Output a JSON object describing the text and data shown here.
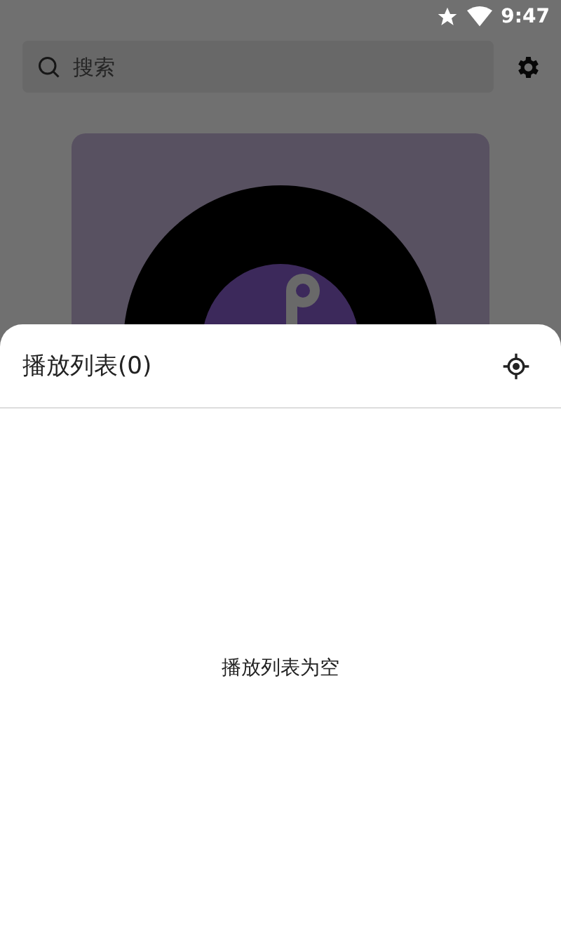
{
  "status_bar": {
    "time": "9:47"
  },
  "search": {
    "placeholder": "搜索"
  },
  "playlist_sheet": {
    "title": "播放列表(0)",
    "empty_message": "播放列表为空"
  }
}
